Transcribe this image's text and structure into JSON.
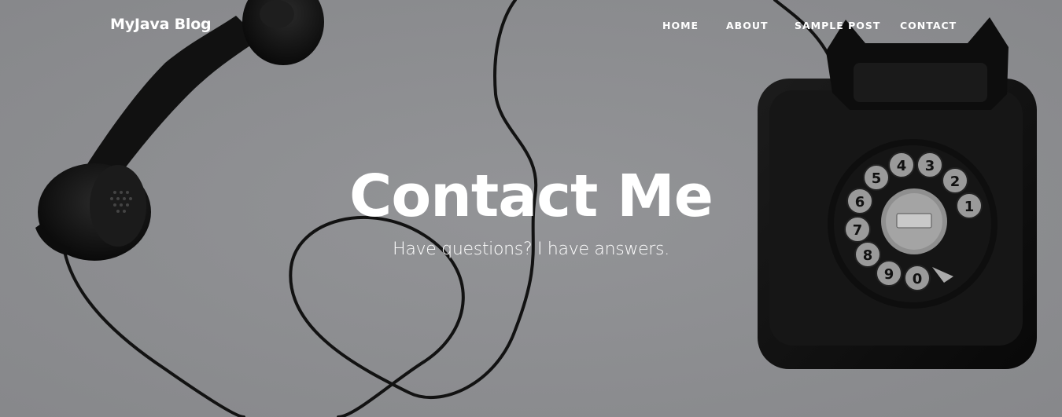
{
  "navbar": {
    "brand": "MyJava Blog",
    "links": [
      {
        "label": "HOME"
      },
      {
        "label": "ABOUT"
      },
      {
        "label": "SAMPLE POST"
      },
      {
        "label": "CONTACT"
      }
    ]
  },
  "header": {
    "title": "Contact Me",
    "subtitle": "Have questions? I have answers."
  },
  "colors": {
    "overlay_gray": "#8d8e91",
    "text": "#ffffff",
    "phone_black": "#121212"
  },
  "images": {
    "background": "black-rotary-telephone-icon"
  }
}
